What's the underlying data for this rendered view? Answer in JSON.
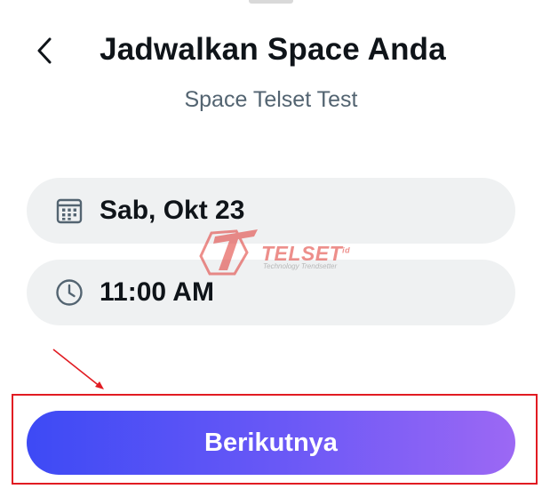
{
  "header": {
    "title": "Jadwalkan Space Anda",
    "subtitle": "Space Telset Test",
    "back_icon": "chevron-left-icon"
  },
  "schedule": {
    "date": {
      "icon": "calendar-icon",
      "value": "Sab, Okt 23"
    },
    "time": {
      "icon": "clock-icon",
      "value": "11:00 AM"
    }
  },
  "watermark": {
    "brand": "TELSET",
    "suffix": "id",
    "tagline": "Technology Trendsetter"
  },
  "footer": {
    "next_label": "Berikutnya"
  },
  "colors": {
    "accent_start": "#3d4af5",
    "accent_end": "#9c68f4",
    "annotation": "#e11b22",
    "pill_bg": "#eff1f2"
  }
}
